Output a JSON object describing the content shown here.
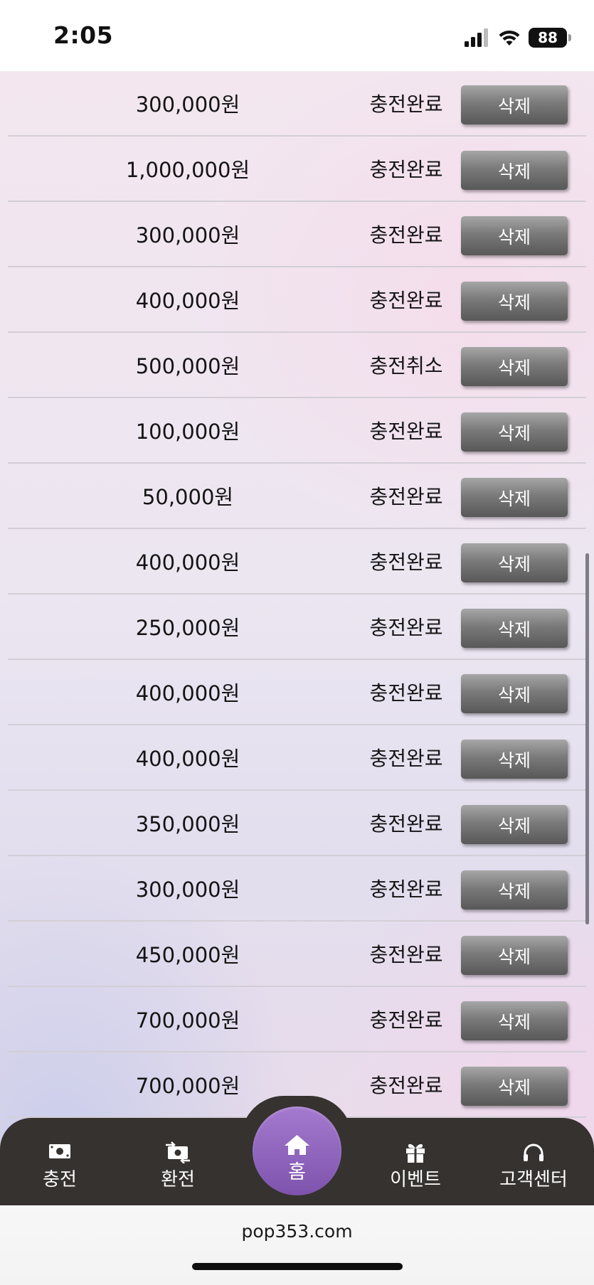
{
  "status_bar": {
    "time": "2:05",
    "battery": "88"
  },
  "list": {
    "delete_label": "삭제",
    "rows": [
      {
        "amount": "300,000원",
        "status": "충전완료"
      },
      {
        "amount": "1,000,000원",
        "status": "충전완료"
      },
      {
        "amount": "300,000원",
        "status": "충전완료"
      },
      {
        "amount": "400,000원",
        "status": "충전완료"
      },
      {
        "amount": "500,000원",
        "status": "충전취소"
      },
      {
        "amount": "100,000원",
        "status": "충전완료"
      },
      {
        "amount": "50,000원",
        "status": "충전완료"
      },
      {
        "amount": "400,000원",
        "status": "충전완료"
      },
      {
        "amount": "250,000원",
        "status": "충전완료"
      },
      {
        "amount": "400,000원",
        "status": "충전완료"
      },
      {
        "amount": "400,000원",
        "status": "충전완료"
      },
      {
        "amount": "350,000원",
        "status": "충전완료"
      },
      {
        "amount": "300,000원",
        "status": "충전완료"
      },
      {
        "amount": "450,000원",
        "status": "충전완료"
      },
      {
        "amount": "700,000원",
        "status": "충전완료"
      },
      {
        "amount": "700,000원",
        "status": "충전완료"
      }
    ]
  },
  "bottom_nav": {
    "charge": {
      "label": "충전",
      "icon": "cash-icon"
    },
    "exchange": {
      "label": "환전",
      "icon": "exchange-icon"
    },
    "home": {
      "label": "홈",
      "icon": "home-icon"
    },
    "event": {
      "label": "이벤트",
      "icon": "gift-icon"
    },
    "support": {
      "label": "고객센터",
      "icon": "headset-icon"
    }
  },
  "browser": {
    "url": "pop353.com"
  },
  "colors": {
    "nav_bg": "#363230",
    "home_accent": "#8e63bf",
    "delete_button": "#6f6f6f"
  }
}
